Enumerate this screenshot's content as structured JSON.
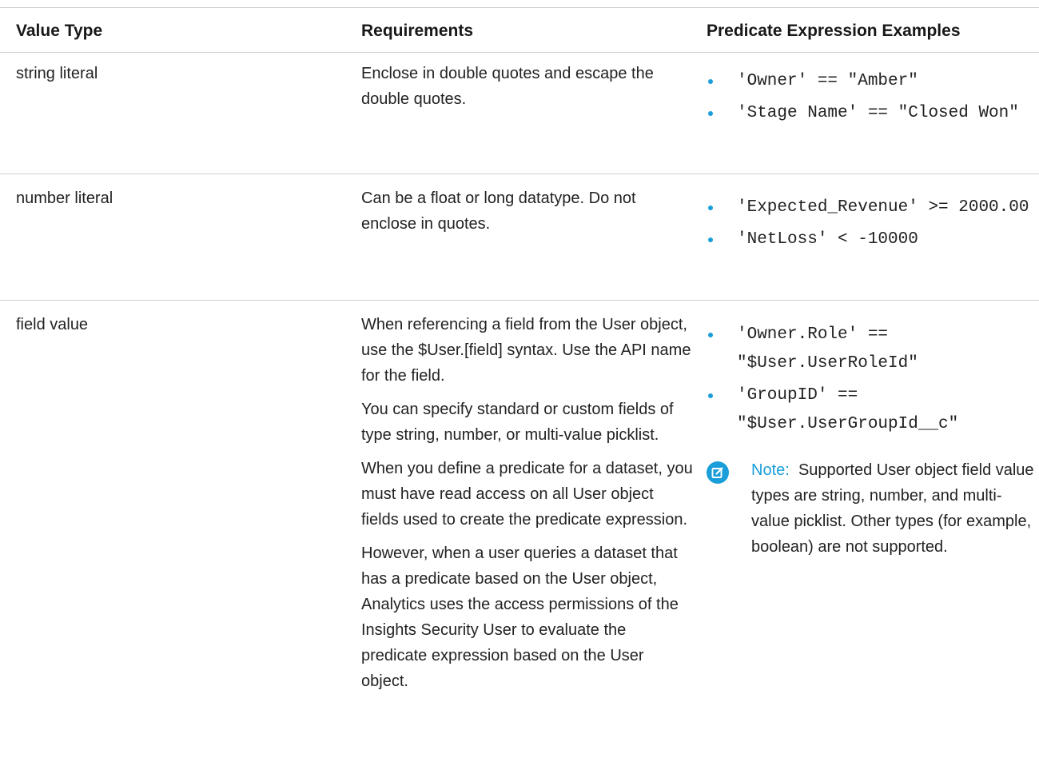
{
  "table": {
    "headers": [
      "Value Type",
      "Requirements",
      "Predicate Expression Examples"
    ],
    "rows": [
      {
        "value_type": "string literal",
        "requirements": [
          "Enclose in double quotes and escape the double quotes."
        ],
        "examples": [
          "'Owner' == \"Amber\"",
          "'Stage Name' == \"Closed Won\""
        ]
      },
      {
        "value_type": "number literal",
        "requirements": [
          "Can be a float or long datatype. Do not enclose in quotes."
        ],
        "examples": [
          "'Expected_Revenue' >= 2000.00",
          "'NetLoss' < -10000"
        ]
      },
      {
        "value_type": "field value",
        "requirements": [
          "When referencing a field from the User object, use the $User.[field] syntax. Use the API name for the field.",
          "You can specify standard or custom fields of type string, number, or multi-value picklist.",
          "When you define a predicate for a dataset, you must have read access on all User object fields used to create the predicate expression.",
          "However, when a user queries a dataset that has a predicate based on the User object, Analytics uses the access permissions of the Insights Security User to evaluate the predicate expression based on the User object."
        ],
        "examples": [
          "'Owner.Role' == \"$User.UserRoleId\"",
          "'GroupID' == \"$User.UserGroupId__c\""
        ],
        "note": {
          "label": "Note:",
          "text": "Supported User object field value types are string, number, and multi-value picklist. Other types (for example, boolean) are not supported."
        }
      }
    ]
  },
  "colors": {
    "accent": "#1a9ed9",
    "rule": "#cfcfcf",
    "text": "#222222"
  },
  "icons": {
    "bullet": "bullet-dot",
    "note": "edit-note-icon"
  }
}
